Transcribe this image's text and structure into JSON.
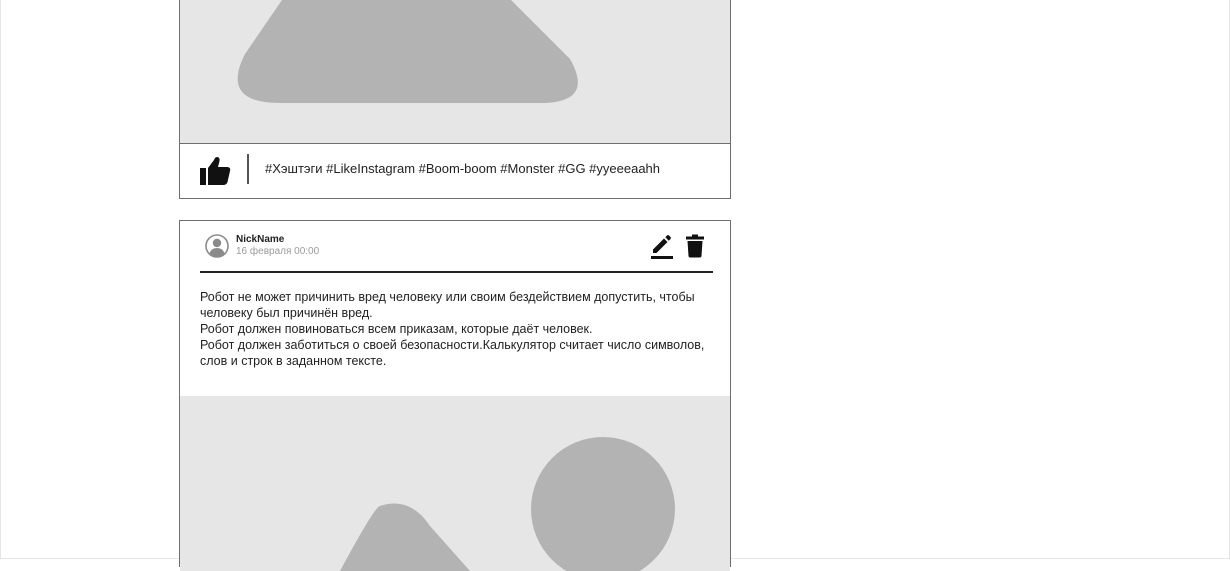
{
  "colors": {
    "placeholder_bg": "#e6e6e6",
    "placeholder_shape": "#b3b3b3",
    "border": "#6e6e6e",
    "text": "#222222",
    "muted": "#9a9a9a"
  },
  "posts": [
    {
      "media": {
        "icon": "image-placeholder-icon"
      },
      "footer": {
        "like_icon": "thumbs-up-icon",
        "hashtags": "#Хэштэги #LikeInstagram #Boom-boom #Monster #GG #yyeeeaahh"
      }
    },
    {
      "header": {
        "avatar_icon": "user-avatar-icon",
        "nickname": "NickName",
        "date": "16 февраля 00:00",
        "edit_icon": "pencil-icon",
        "delete_icon": "trash-icon"
      },
      "body": {
        "lines": [
          "Робот не может причинить вред человеку или своим бездействием допустить, чтобы человеку был причинён вред.",
          "Робот должен повиноваться всем приказам, которые даёт человек.",
          "Робот должен заботиться о своей безопасности.Калькулятор считает число символов, слов и строк в заданном тексте."
        ]
      },
      "media": {
        "icon": "image-placeholder-icon"
      }
    }
  ]
}
